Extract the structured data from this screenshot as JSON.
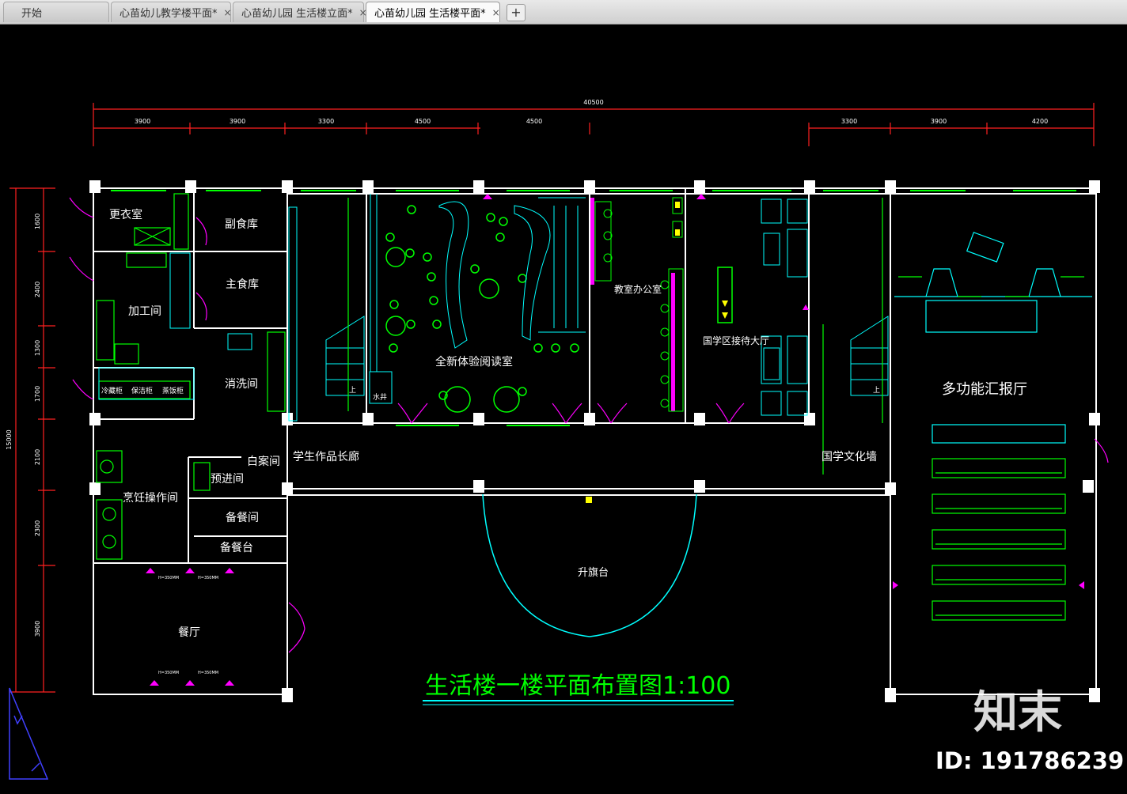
{
  "tabs": [
    {
      "label": "开始"
    },
    {
      "label": "心苗幼儿教学楼平面*"
    },
    {
      "label": "心苗幼儿园 生活楼立面*"
    },
    {
      "label": "心苗幼儿园 生活楼平面*"
    }
  ],
  "new_tab_symbol": "+",
  "close_symbol": "×",
  "drawing": {
    "title": "生活楼一楼平面布置图1:100",
    "dims_top_total": "40500",
    "dims_top": [
      "3900",
      "3900",
      "3300",
      "4500",
      "4500",
      "3300",
      "3900",
      "4200"
    ],
    "dims_left_total": "15000",
    "dims_left": [
      "1600",
      "2400",
      "2100",
      "1300",
      "1700",
      "2100",
      "2300",
      "3900"
    ],
    "rooms": {
      "changing": "更衣室",
      "sub_store": "副食库",
      "main_store": "主食库",
      "process": "加工间",
      "wash": "消洗间",
      "cold": "冷藏柜",
      "keep": "保洁柜",
      "steam": "蒸饭柜",
      "cook": "烹饪操作间",
      "pre": "预进间",
      "case": "白案间",
      "prep": "备餐间",
      "prep_table": "备餐台",
      "dining": "餐厅",
      "corridor": "学生作品长廊",
      "water": "水井",
      "reading": "全新体验阅读室",
      "office": "教室办公室",
      "reception": "国学区接待大厅",
      "culture_wall": "国学文化墙",
      "hall": "多功能汇报厅",
      "flag": "升旗台",
      "up1": "上",
      "up2": "上",
      "h1": "H=350MM",
      "h2": "H=350MM",
      "h3": "H=350MM",
      "h4": "H=350MM"
    }
  },
  "watermark": {
    "brand": "知末",
    "id": "ID: 191786239"
  },
  "colors": {
    "wall": "#ffffff",
    "green": "#00ff00",
    "cyan": "#00ffff",
    "yellow": "#ffff00",
    "red": "#ff2020",
    "magenta": "#ff00ff"
  }
}
